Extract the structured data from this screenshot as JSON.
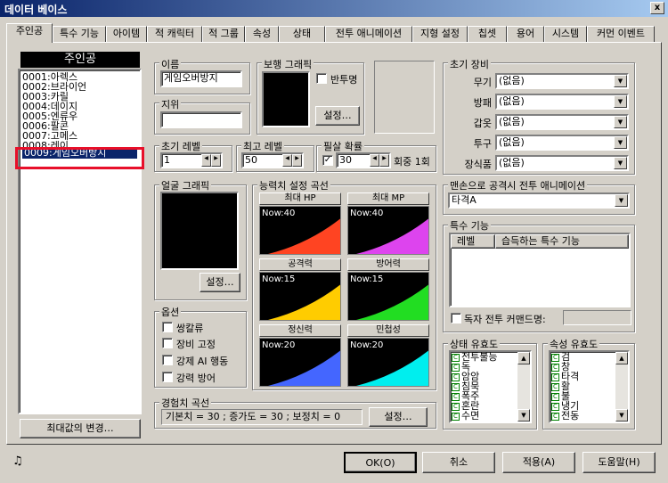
{
  "window": {
    "title": "데이터 베이스",
    "close_label": "x"
  },
  "tabs": [
    "주인공",
    "특수 기능",
    "아이템",
    "적 캐릭터",
    "적 그룹",
    "속성",
    "상태",
    "전투 애니메이션",
    "지형 설정",
    "칩셋",
    "용어",
    "시스템",
    "커먼 이벤트"
  ],
  "hero_list": {
    "header": "주인공",
    "items": [
      "0001:아렉스",
      "0002:브라이언",
      "0003:카릴",
      "0004:데이지",
      "0005:엔류우",
      "0006:팔콘",
      "0007:고메스",
      "0008:레이",
      "0009:게임오버방지"
    ],
    "selected": "0009:게임오버방지",
    "change_max_label": "최대값의 변경…"
  },
  "name": {
    "label": "이름",
    "value": "게임오버방지"
  },
  "title_field": {
    "label": "지위",
    "value": ""
  },
  "walk_graphic": {
    "label": "보행 그래픽",
    "translucent_label": "반투명",
    "set_label": "설정…"
  },
  "init_level": {
    "label": "초기 레벨",
    "value": "1"
  },
  "max_level": {
    "label": "최고 레벨",
    "value": "50"
  },
  "critical": {
    "label": "필살 확률",
    "value": "30",
    "suffix": "회중 1회",
    "checked": "✓"
  },
  "face_graphic": {
    "label": "얼굴 그래픽",
    "set_label": "설정…"
  },
  "stat_curves": {
    "label": "능력치 설정 곡선",
    "items": [
      {
        "title": "최대 HP",
        "now": "Now:40",
        "color": "#ff4422"
      },
      {
        "title": "최대 MP",
        "now": "Now:40",
        "color": "#dd44ee"
      },
      {
        "title": "공격력",
        "now": "Now:15",
        "color": "#ffcc00"
      },
      {
        "title": "방어력",
        "now": "Now:15",
        "color": "#22dd22"
      },
      {
        "title": "정신력",
        "now": "Now:20",
        "color": "#4466ff"
      },
      {
        "title": "민첩성",
        "now": "Now:20",
        "color": "#00eeee"
      }
    ]
  },
  "options": {
    "label": "옵션",
    "items": [
      "쌍칼류",
      "장비 고정",
      "강제 AI 행동",
      "강력 방어"
    ]
  },
  "exp_curve": {
    "label": "경험치 곡선",
    "text": "기본치 = 30 ; 증가도 = 30 ; 보정치 = 0",
    "set_label": "설정…"
  },
  "equipment": {
    "label": "초기 장비",
    "slots": [
      {
        "label": "무기",
        "value": "(없음)"
      },
      {
        "label": "방패",
        "value": "(없음)"
      },
      {
        "label": "갑옷",
        "value": "(없음)"
      },
      {
        "label": "투구",
        "value": "(없음)"
      },
      {
        "label": "장식품",
        "value": "(없음)"
      }
    ]
  },
  "unarmed_anim": {
    "label": "맨손으로 공격시 전투 애니메이션",
    "value": "타격A"
  },
  "skills": {
    "label": "특수 기능",
    "col_level": "레벨",
    "col_skill": "습득하는 특수 기능",
    "unique_cmd_label": "독자 전투 커맨드명:",
    "unique_cmd_value": ""
  },
  "state_eff": {
    "label": "상태 유효도",
    "items": [
      "전투불능",
      "독",
      "암암",
      "침묵",
      "폭주",
      "혼란",
      "수면"
    ]
  },
  "attr_eff": {
    "label": "속성 유효도",
    "items": [
      "검",
      "창",
      "타격",
      "활",
      "불",
      "냉기",
      "전동"
    ]
  },
  "footer": {
    "ok": "OK(O)",
    "cancel": "취소",
    "apply": "적용(A)",
    "help": "도움말(H)",
    "music_icon": "♫"
  }
}
